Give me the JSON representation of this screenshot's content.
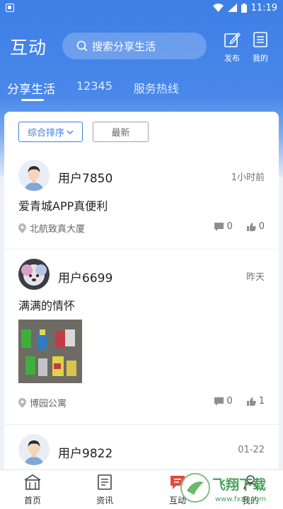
{
  "status_bar": {
    "time": "11:19"
  },
  "header": {
    "title": "互动",
    "search_placeholder": "搜索分享生活",
    "publish_label": "发布",
    "mine_label": "我的"
  },
  "tabs": [
    {
      "label": "分享生活"
    },
    {
      "label": "12345"
    },
    {
      "label": "服务热线"
    }
  ],
  "sort": {
    "option_1": "综合排序",
    "option_2": "最新"
  },
  "posts": [
    {
      "username": "用户7850",
      "time": "1小时前",
      "content": "爱青城APP真便利",
      "location": "北航致真大厦",
      "comments": "0",
      "likes": "0"
    },
    {
      "username": "用户6699",
      "time": "昨天",
      "content": "满满的情怀",
      "location": "博园公寓",
      "comments": "0",
      "likes": "1"
    },
    {
      "username": "用户9822",
      "time": "01-22"
    }
  ],
  "bottom_nav": [
    {
      "label": "首页"
    },
    {
      "label": "资讯"
    },
    {
      "label": "互动"
    },
    {
      "label": "我的"
    }
  ],
  "watermark": {
    "text": "飞翔下载",
    "url": "www.fxxz.com"
  },
  "colors": {
    "primary": "#3d7fe6",
    "card_bg": "#ffffff",
    "text": "#222222"
  }
}
